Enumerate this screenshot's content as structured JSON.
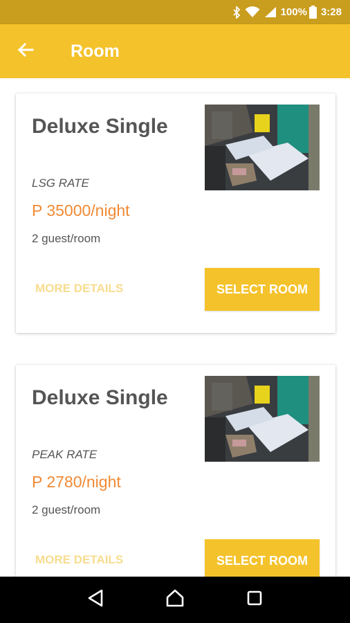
{
  "status_bar": {
    "battery": "100%",
    "time": "3:28",
    "icons": [
      "bluetooth-icon",
      "wifi-icon",
      "signal-icon",
      "battery-icon"
    ]
  },
  "app_bar": {
    "title": "Room",
    "back_icon": "arrow-left-icon"
  },
  "rooms": [
    {
      "name": "Deluxe Single",
      "rate": "LSG RATE",
      "price": "P 35000/night",
      "guests": "2 guest/room",
      "more_details": "MORE DETAILS",
      "select": "SELECT ROOM"
    },
    {
      "name": "Deluxe Single",
      "rate": "PEAK RATE",
      "price": "P 2780/night",
      "guests": "2 guest/room",
      "more_details": "MORE DETAILS",
      "select": "SELECT ROOM"
    }
  ],
  "nav_bar": {
    "buttons": [
      "back-triangle-icon",
      "home-icon",
      "recents-square-icon"
    ]
  },
  "colors": {
    "status_bar": "#c99d1e",
    "accent": "#f4c22b",
    "price": "#f08a34",
    "more_details": "#f8dc8e",
    "text": "#555555"
  }
}
